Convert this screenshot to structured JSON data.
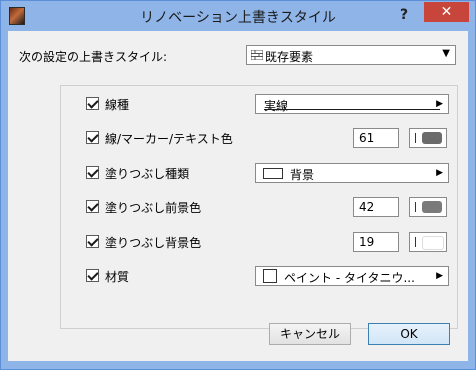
{
  "window": {
    "title": "リノベーション上書きスタイル",
    "help": "?",
    "close": "✕"
  },
  "style": {
    "label": "次の設定の上書きスタイル:",
    "selected": "既存要素"
  },
  "rows": [
    {
      "name": "線種",
      "value": "実線"
    },
    {
      "name": "線/マーカー/テキスト色",
      "pen": "61",
      "pen_color": "#6b6b6b"
    },
    {
      "name": "塗りつぶし種類",
      "value": "背景"
    },
    {
      "name": "塗りつぶし前景色",
      "pen": "42",
      "pen_color": "#7a7a7a"
    },
    {
      "name": "塗りつぶし背景色",
      "pen": "19",
      "pen_color": "#ffffff"
    },
    {
      "name": "材質",
      "value": "ペイント - タイタニウ..."
    }
  ],
  "buttons": {
    "cancel": "キャンセル",
    "ok": "OK"
  }
}
